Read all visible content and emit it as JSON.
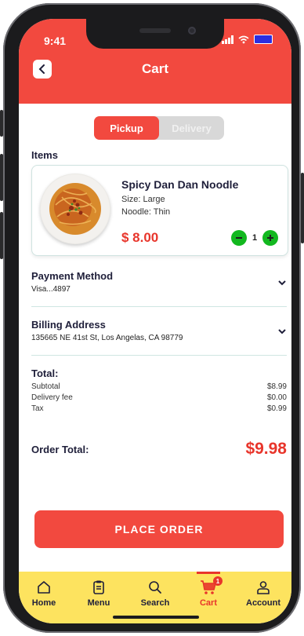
{
  "status_bar": {
    "time": "9:41"
  },
  "header": {
    "title": "Cart"
  },
  "order_type": {
    "options": [
      "Pickup",
      "Delivery"
    ],
    "selected": "Pickup"
  },
  "items_section": {
    "title": "Items"
  },
  "item": {
    "name": "Spicy Dan Dan Noodle",
    "size": "Size: Large",
    "noodle": "Noodle: Thin",
    "price": "$ 8.00",
    "quantity": "1"
  },
  "payment": {
    "title": "Payment Method",
    "value": "Visa...4897"
  },
  "billing": {
    "title": "Billing Address",
    "value": "135665 NE 41st St, Los Angelas, CA 98779"
  },
  "totals": {
    "title": "Total:",
    "rows": [
      {
        "label": "Subtotal",
        "value": "$8.99"
      },
      {
        "label": "Delivery fee",
        "value": "$0.00"
      },
      {
        "label": "Tax",
        "value": "$0.99"
      }
    ],
    "order_total_label": "Order Total:",
    "order_total_value": "$9.98"
  },
  "place_order": {
    "label": "PLACE ORDER"
  },
  "tabbar": {
    "tabs": [
      {
        "label": "Home",
        "icon": "home-icon"
      },
      {
        "label": "Menu",
        "icon": "menu-clipboard-icon"
      },
      {
        "label": "Search",
        "icon": "search-icon"
      },
      {
        "label": "Cart",
        "icon": "cart-icon",
        "badge": "1",
        "active": true
      },
      {
        "label": "Account",
        "icon": "account-icon"
      }
    ]
  },
  "colors": {
    "primary": "#f2493f",
    "tabbar": "#fde35f",
    "accent_green": "#12b81f",
    "price_red": "#e8352b"
  }
}
